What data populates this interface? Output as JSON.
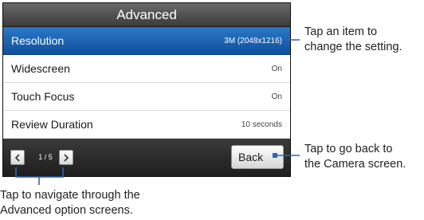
{
  "screen": {
    "title": "Advanced",
    "settings": [
      {
        "label": "Resolution",
        "value": "3M (2048x1216)",
        "selected": true
      },
      {
        "label": "Widescreen",
        "value": "On",
        "selected": false
      },
      {
        "label": "Touch Focus",
        "value": "On",
        "selected": false
      },
      {
        "label": "Review Duration",
        "value": "10 seconds",
        "selected": false
      }
    ],
    "pager": {
      "indicator": "1 / 5"
    },
    "back_label": "Back"
  },
  "callouts": {
    "item": {
      "line1": "Tap an item to",
      "line2": "change the setting."
    },
    "back": {
      "line1": "Tap to go back to",
      "line2": "the Camera screen."
    },
    "nav": {
      "line1": "Tap to navigate through the",
      "line2": "Advanced option screens."
    }
  },
  "colors": {
    "selected_row": "#1a60ad",
    "callout_line": "#2a66b4",
    "footer": "#2b2b2b",
    "header": "#4d4d4d"
  },
  "icons": {
    "prev": "chevron-left-icon",
    "next": "chevron-right-icon",
    "back_marker": "square-marker-icon"
  }
}
